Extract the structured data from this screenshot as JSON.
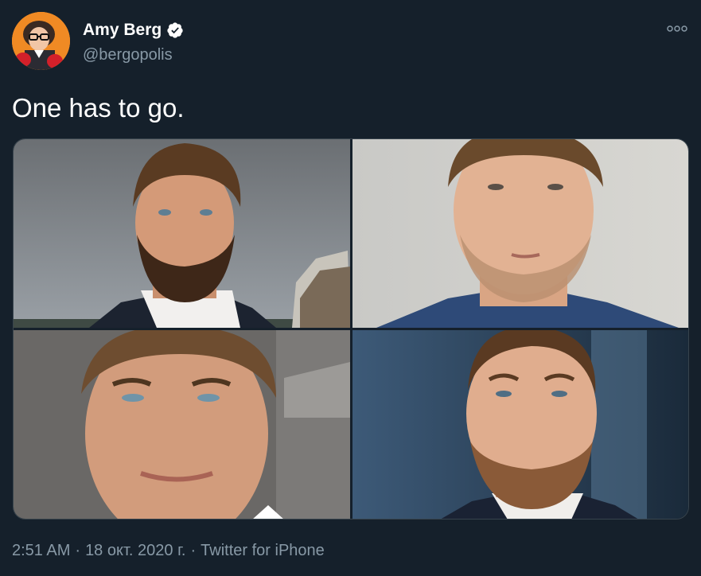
{
  "author": {
    "display_name": "Amy Berg",
    "handle": "@bergopolis",
    "verified": true
  },
  "icons": {
    "avatar": "avatar-icon",
    "verified": "verified-badge-icon",
    "more": "more-horizontal-icon"
  },
  "tweet": {
    "text": "One has to go."
  },
  "media": {
    "photos": [
      {
        "name": "photo-1"
      },
      {
        "name": "photo-2"
      },
      {
        "name": "photo-3"
      },
      {
        "name": "photo-4"
      }
    ]
  },
  "meta": {
    "time": "2:51 AM",
    "sep1": "·",
    "date": "18 окт. 2020 г.",
    "sep2": "·",
    "source": "Twitter for iPhone"
  },
  "colors": {
    "background": "#15202b",
    "text_primary": "#ffffff",
    "text_secondary": "#8899a6",
    "border": "#38444d"
  }
}
